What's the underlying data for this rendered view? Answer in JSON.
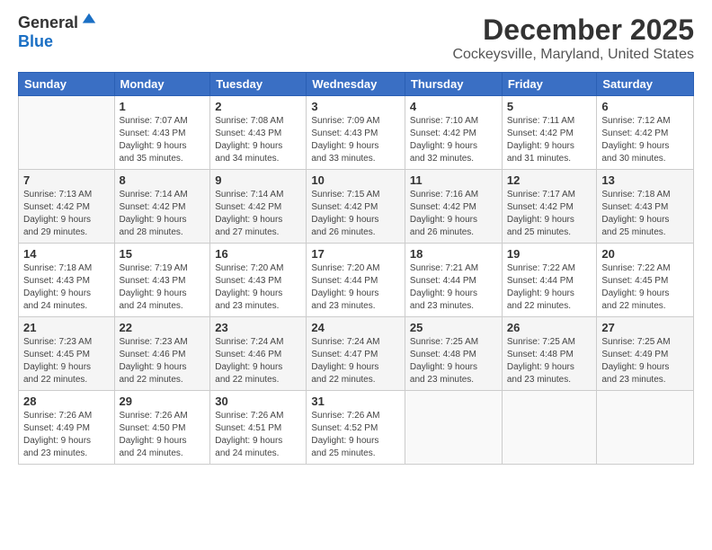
{
  "header": {
    "logo_line1": "General",
    "logo_line2": "Blue",
    "title": "December 2025",
    "subtitle": "Cockeysville, Maryland, United States"
  },
  "weekdays": [
    "Sunday",
    "Monday",
    "Tuesday",
    "Wednesday",
    "Thursday",
    "Friday",
    "Saturday"
  ],
  "weeks": [
    [
      {
        "day": "",
        "info": ""
      },
      {
        "day": "1",
        "info": "Sunrise: 7:07 AM\nSunset: 4:43 PM\nDaylight: 9 hours\nand 35 minutes."
      },
      {
        "day": "2",
        "info": "Sunrise: 7:08 AM\nSunset: 4:43 PM\nDaylight: 9 hours\nand 34 minutes."
      },
      {
        "day": "3",
        "info": "Sunrise: 7:09 AM\nSunset: 4:43 PM\nDaylight: 9 hours\nand 33 minutes."
      },
      {
        "day": "4",
        "info": "Sunrise: 7:10 AM\nSunset: 4:42 PM\nDaylight: 9 hours\nand 32 minutes."
      },
      {
        "day": "5",
        "info": "Sunrise: 7:11 AM\nSunset: 4:42 PM\nDaylight: 9 hours\nand 31 minutes."
      },
      {
        "day": "6",
        "info": "Sunrise: 7:12 AM\nSunset: 4:42 PM\nDaylight: 9 hours\nand 30 minutes."
      }
    ],
    [
      {
        "day": "7",
        "info": "Sunrise: 7:13 AM\nSunset: 4:42 PM\nDaylight: 9 hours\nand 29 minutes."
      },
      {
        "day": "8",
        "info": "Sunrise: 7:14 AM\nSunset: 4:42 PM\nDaylight: 9 hours\nand 28 minutes."
      },
      {
        "day": "9",
        "info": "Sunrise: 7:14 AM\nSunset: 4:42 PM\nDaylight: 9 hours\nand 27 minutes."
      },
      {
        "day": "10",
        "info": "Sunrise: 7:15 AM\nSunset: 4:42 PM\nDaylight: 9 hours\nand 26 minutes."
      },
      {
        "day": "11",
        "info": "Sunrise: 7:16 AM\nSunset: 4:42 PM\nDaylight: 9 hours\nand 26 minutes."
      },
      {
        "day": "12",
        "info": "Sunrise: 7:17 AM\nSunset: 4:42 PM\nDaylight: 9 hours\nand 25 minutes."
      },
      {
        "day": "13",
        "info": "Sunrise: 7:18 AM\nSunset: 4:43 PM\nDaylight: 9 hours\nand 25 minutes."
      }
    ],
    [
      {
        "day": "14",
        "info": "Sunrise: 7:18 AM\nSunset: 4:43 PM\nDaylight: 9 hours\nand 24 minutes."
      },
      {
        "day": "15",
        "info": "Sunrise: 7:19 AM\nSunset: 4:43 PM\nDaylight: 9 hours\nand 24 minutes."
      },
      {
        "day": "16",
        "info": "Sunrise: 7:20 AM\nSunset: 4:43 PM\nDaylight: 9 hours\nand 23 minutes."
      },
      {
        "day": "17",
        "info": "Sunrise: 7:20 AM\nSunset: 4:44 PM\nDaylight: 9 hours\nand 23 minutes."
      },
      {
        "day": "18",
        "info": "Sunrise: 7:21 AM\nSunset: 4:44 PM\nDaylight: 9 hours\nand 23 minutes."
      },
      {
        "day": "19",
        "info": "Sunrise: 7:22 AM\nSunset: 4:44 PM\nDaylight: 9 hours\nand 22 minutes."
      },
      {
        "day": "20",
        "info": "Sunrise: 7:22 AM\nSunset: 4:45 PM\nDaylight: 9 hours\nand 22 minutes."
      }
    ],
    [
      {
        "day": "21",
        "info": "Sunrise: 7:23 AM\nSunset: 4:45 PM\nDaylight: 9 hours\nand 22 minutes."
      },
      {
        "day": "22",
        "info": "Sunrise: 7:23 AM\nSunset: 4:46 PM\nDaylight: 9 hours\nand 22 minutes."
      },
      {
        "day": "23",
        "info": "Sunrise: 7:24 AM\nSunset: 4:46 PM\nDaylight: 9 hours\nand 22 minutes."
      },
      {
        "day": "24",
        "info": "Sunrise: 7:24 AM\nSunset: 4:47 PM\nDaylight: 9 hours\nand 22 minutes."
      },
      {
        "day": "25",
        "info": "Sunrise: 7:25 AM\nSunset: 4:48 PM\nDaylight: 9 hours\nand 23 minutes."
      },
      {
        "day": "26",
        "info": "Sunrise: 7:25 AM\nSunset: 4:48 PM\nDaylight: 9 hours\nand 23 minutes."
      },
      {
        "day": "27",
        "info": "Sunrise: 7:25 AM\nSunset: 4:49 PM\nDaylight: 9 hours\nand 23 minutes."
      }
    ],
    [
      {
        "day": "28",
        "info": "Sunrise: 7:26 AM\nSunset: 4:49 PM\nDaylight: 9 hours\nand 23 minutes."
      },
      {
        "day": "29",
        "info": "Sunrise: 7:26 AM\nSunset: 4:50 PM\nDaylight: 9 hours\nand 24 minutes."
      },
      {
        "day": "30",
        "info": "Sunrise: 7:26 AM\nSunset: 4:51 PM\nDaylight: 9 hours\nand 24 minutes."
      },
      {
        "day": "31",
        "info": "Sunrise: 7:26 AM\nSunset: 4:52 PM\nDaylight: 9 hours\nand 25 minutes."
      },
      {
        "day": "",
        "info": ""
      },
      {
        "day": "",
        "info": ""
      },
      {
        "day": "",
        "info": ""
      }
    ]
  ]
}
